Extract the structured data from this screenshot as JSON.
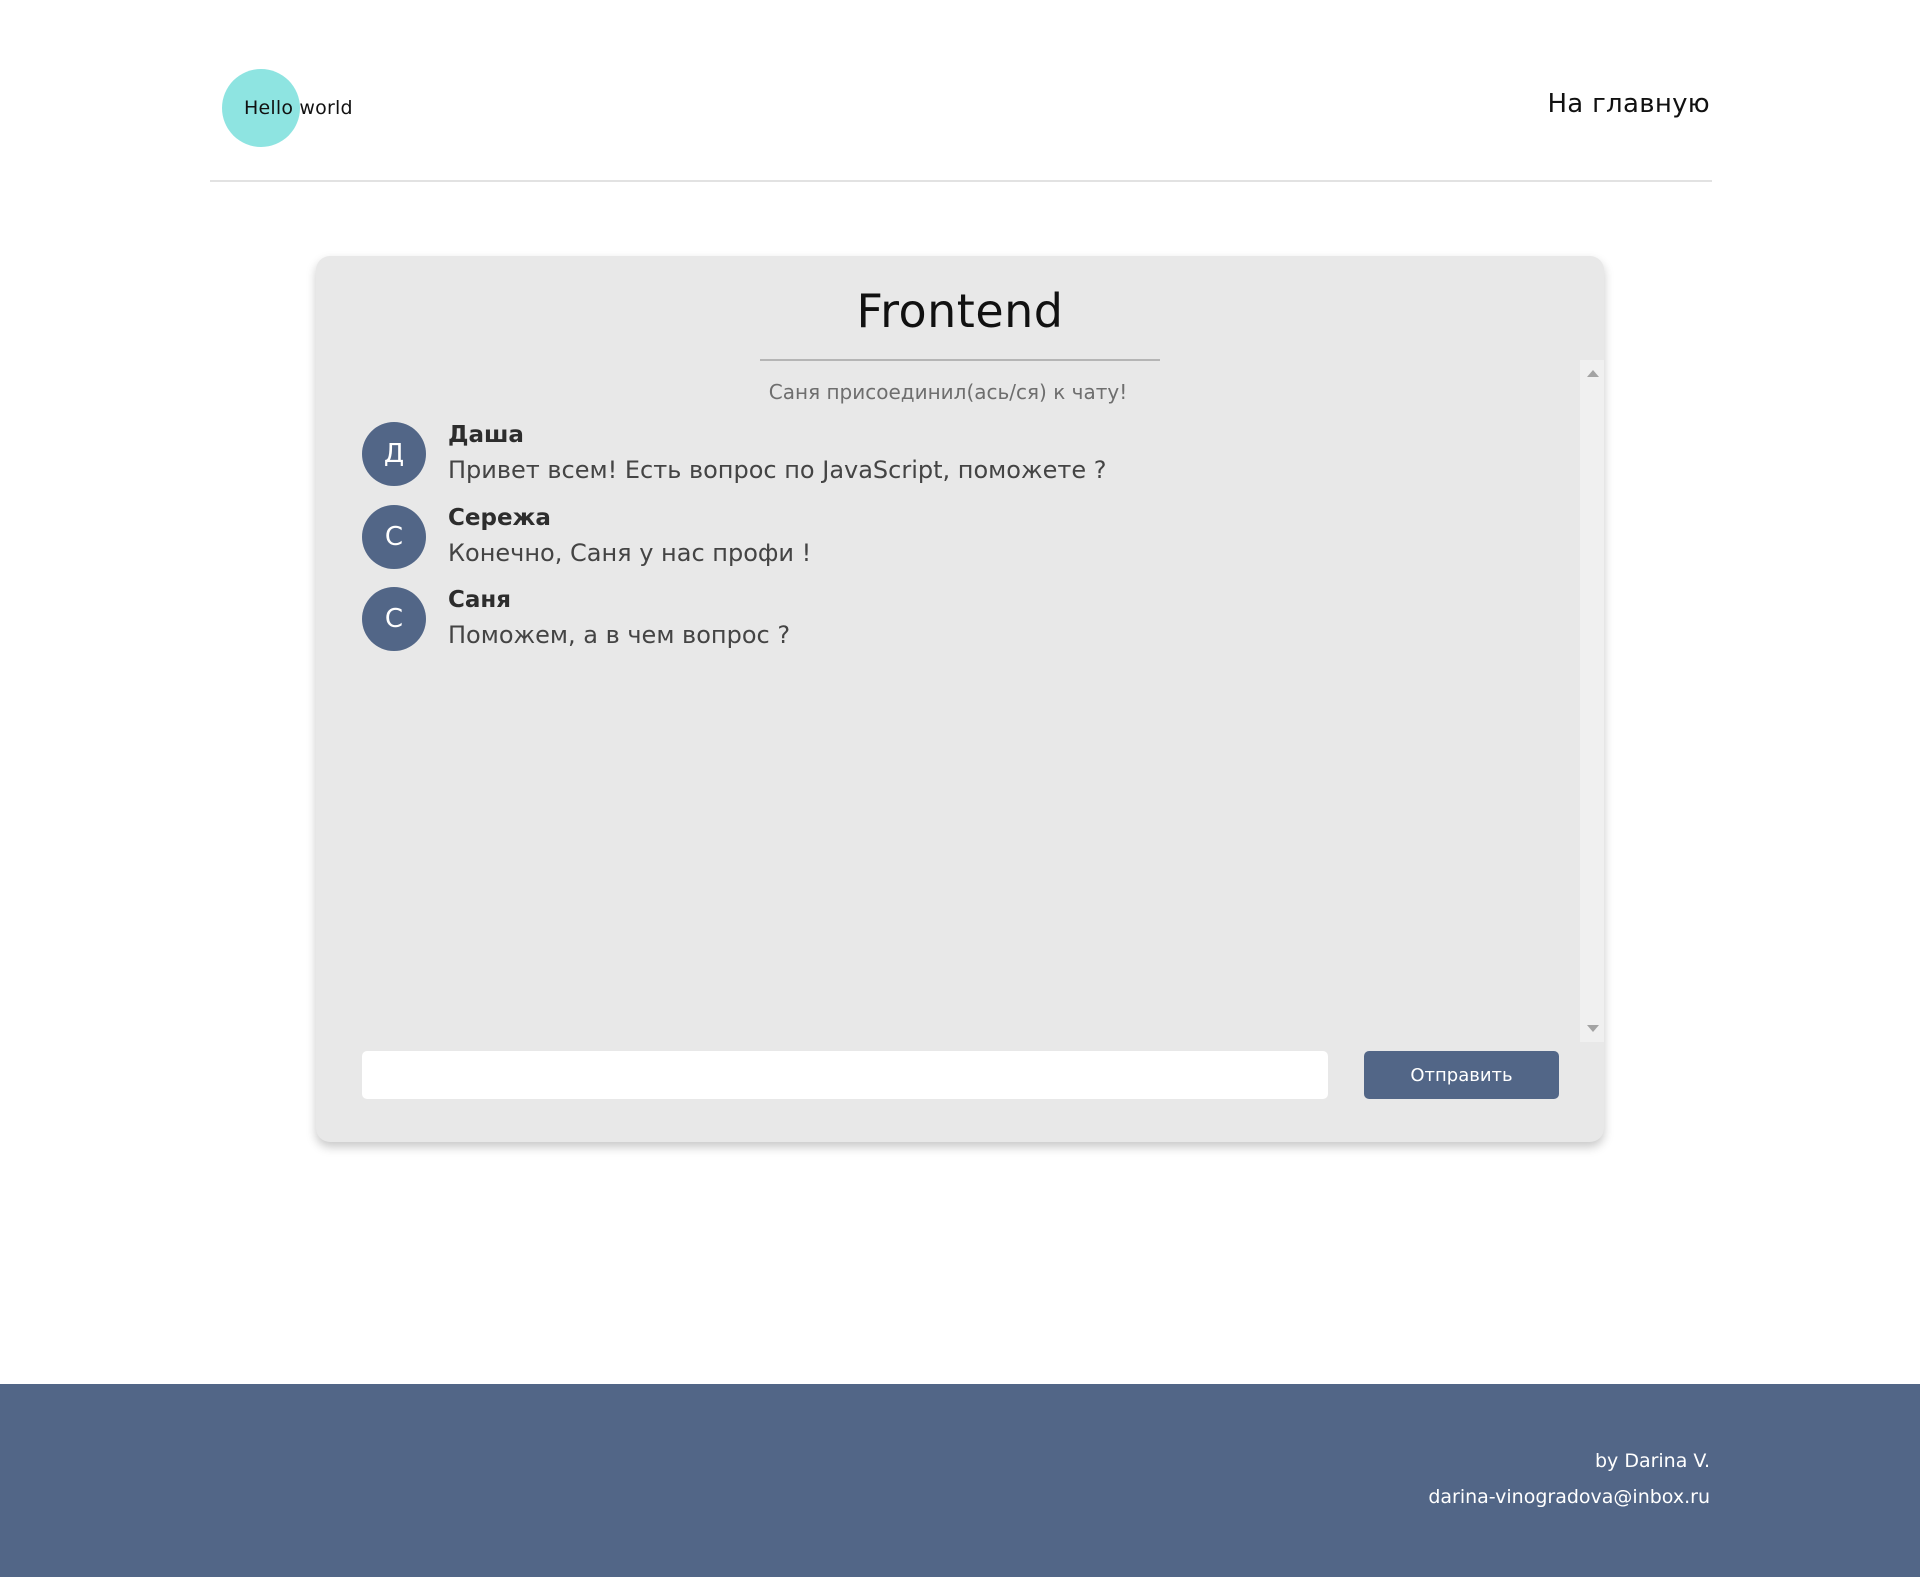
{
  "header": {
    "logo_text": "Hello world",
    "nav_home_label": "На главную"
  },
  "chat": {
    "title": "Frontend",
    "system_message": "Саня присоединил(ась/ся) к чату!",
    "messages": [
      {
        "avatar_letter": "Д",
        "author": "Даша",
        "text": "Привет всем! Есть вопрос по JavaScript, поможете ?"
      },
      {
        "avatar_letter": "С",
        "author": "Сережа",
        "text": "Конечно, Саня у нас профи !"
      },
      {
        "avatar_letter": "С",
        "author": "Саня",
        "text": "Поможем, а в чем вопрос ?"
      }
    ],
    "input": {
      "value": "",
      "placeholder": ""
    },
    "send_label": "Отправить"
  },
  "footer": {
    "author": "by Darina V.",
    "email": "darina-vinogradova@inbox.ru"
  },
  "colors": {
    "accent": "#526687",
    "logo_circle": "#8ee4e1",
    "card_background": "#e8e8e8"
  },
  "icons": {
    "scroll_up": "triangle-up-icon",
    "scroll_down": "triangle-down-icon"
  }
}
